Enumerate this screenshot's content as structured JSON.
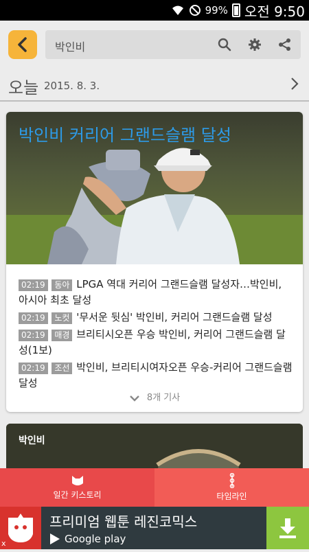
{
  "status_bar": {
    "battery": "99%",
    "time": "오전 9:50",
    "icons": [
      "wifi-icon",
      "do-not-disturb-icon",
      "battery-icon"
    ]
  },
  "top_bar": {
    "search_query": "박인비",
    "icons": [
      "back-icon",
      "search-icon",
      "gear-icon",
      "share-icon"
    ],
    "accent_color": "#f6b43a"
  },
  "date_bar": {
    "today_label": "오늘",
    "date": "2015. 8. 3."
  },
  "story_card": {
    "title": "박인비 커리어 그랜드슬램 달성",
    "title_color": "#2d9be8",
    "news": [
      {
        "time": "02:19",
        "source": "동아",
        "headline": "LPGA 역대 커리어 그랜드슬램 달성자…박인비, 아시아 최초 달성"
      },
      {
        "time": "02:19",
        "source": "노컷",
        "headline": "'무서운 뒷심' 박인비, 커리어 그랜드슬램 달성"
      },
      {
        "time": "02:19",
        "source": "매경",
        "headline": "브리티시오픈 우승 박인비, 커리어 그랜드슬램 달성(1보)"
      },
      {
        "time": "02:19",
        "source": "조선",
        "headline": "박인비, 브리티시여자오픈 우승-커리어 그랜드슬램 달성"
      }
    ],
    "more_label": "8개 기사"
  },
  "second_card": {
    "label": "박인비"
  },
  "bottom_nav": {
    "weekly_story": "일간 키스토리",
    "timeline": "타임라인",
    "color": "#f25c56"
  },
  "ad_banner": {
    "headline": "프리미엄 웹툰 레진코믹스",
    "store": "Google play",
    "close": "x",
    "download_color": "#8dc63f"
  }
}
